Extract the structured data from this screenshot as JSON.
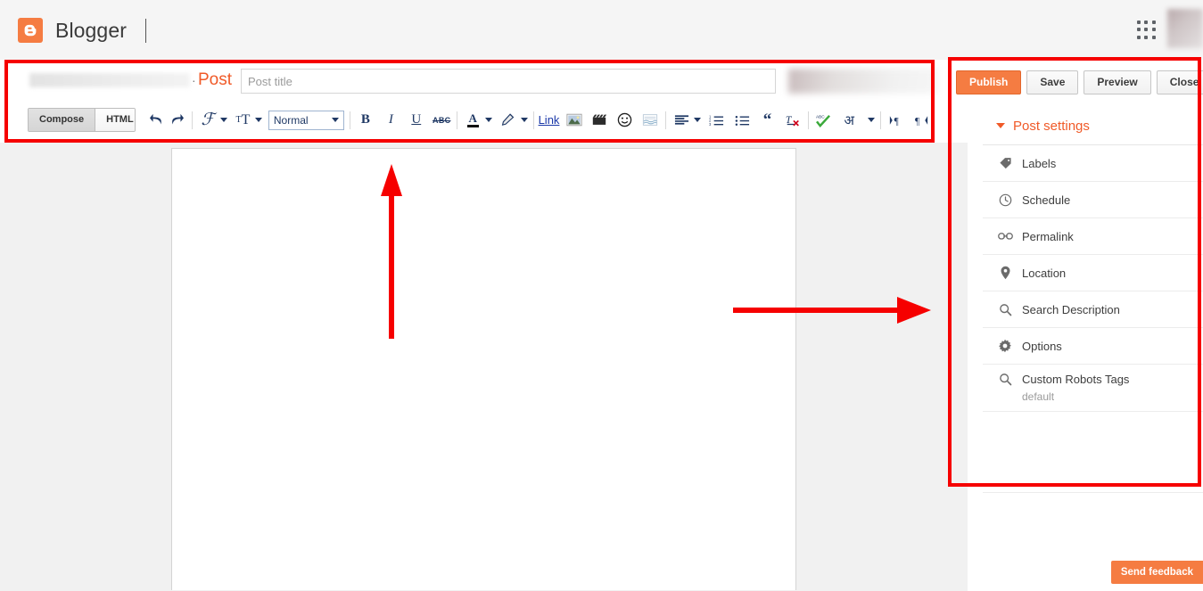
{
  "topbar": {
    "brand": "Blogger",
    "logo_icon": "blogger-logo-icon",
    "apps_icon": "apps-grid-icon",
    "avatar_icon": "user-avatar"
  },
  "editor_header": {
    "separator": "·",
    "post_word": "Post",
    "title_placeholder": "Post title",
    "title_value": ""
  },
  "toolbar": {
    "compose_label": "Compose",
    "html_label": "HTML",
    "undo_icon": "undo-icon",
    "redo_icon": "redo-icon",
    "font_family_icon": "font-family-icon",
    "font_family_glyph": "ℱ",
    "font_size_icon": "font-size-icon",
    "font_size_glyph": "ᴛT",
    "format_select_value": "Normal",
    "bold_label": "B",
    "italic_label": "I",
    "underline_label": "U",
    "strikethrough_label": "ABC",
    "text_color_label": "A",
    "highlight_icon": "highlight-pen-icon",
    "link_label": "Link",
    "insert_image_icon": "insert-image-icon",
    "insert_video_icon": "insert-video-icon",
    "insert_emoji_icon": "insert-emoji-icon",
    "jump_break_icon": "jump-break-icon",
    "align_icon": "align-left-icon",
    "numbered_list_icon": "numbered-list-icon",
    "bulleted_list_icon": "bulleted-list-icon",
    "quote_icon": "blockquote-icon",
    "remove_formatting_icon": "remove-formatting-icon",
    "spellcheck_icon": "spellcheck-icon",
    "transliteration_label": "अ",
    "ltr_icon": "text-direction-ltr-icon",
    "rtl_icon": "text-direction-rtl-icon"
  },
  "sidebar": {
    "publish_label": "Publish",
    "save_label": "Save",
    "preview_label": "Preview",
    "close_label": "Close",
    "post_settings_label": "Post settings",
    "items": [
      {
        "label": "Labels",
        "icon": "label-tag-icon",
        "sub": ""
      },
      {
        "label": "Schedule",
        "icon": "clock-icon",
        "sub": ""
      },
      {
        "label": "Permalink",
        "icon": "link-chain-icon",
        "sub": ""
      },
      {
        "label": "Location",
        "icon": "location-pin-icon",
        "sub": ""
      },
      {
        "label": "Search Description",
        "icon": "magnifier-icon",
        "sub": ""
      },
      {
        "label": "Options",
        "icon": "gear-icon",
        "sub": ""
      },
      {
        "label": "Custom Robots Tags",
        "icon": "magnifier-icon",
        "sub": "default"
      }
    ]
  },
  "footer": {
    "send_feedback_label": "Send feedback"
  },
  "annotations": {
    "accent_red": "#f60000",
    "brand_orange": "#f57c42",
    "post_orange": "#f05a28",
    "editor_box": "highlight-editor-toolbar",
    "sidebar_box": "highlight-post-settings-panel",
    "arrow_up": "arrow-pointing-up-to-toolbar",
    "arrow_right": "arrow-pointing-right-to-post-settings"
  }
}
